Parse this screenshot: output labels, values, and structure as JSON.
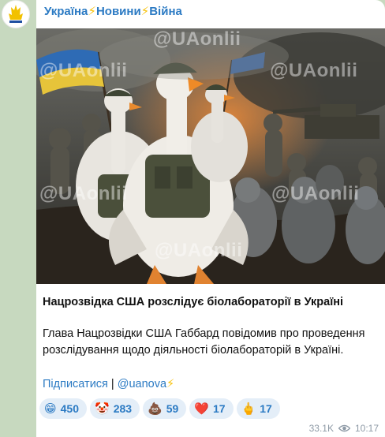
{
  "channel": {
    "header_part1": "Україна",
    "header_part2": "Новини",
    "header_part3": "Війна",
    "header_separator": "⚡"
  },
  "post": {
    "image_watermarks": [
      "@UAonlii",
      "@UAonlii",
      "@UAonlii",
      "@UAonlii",
      "@UAonlii",
      "@UAonlii"
    ],
    "headline": "Нацрозвідка США розслідує біолабораторії в Україні",
    "body_lines": [
      "Глава Нацрозвідки США Габбард повідомив про проведення",
      "розслідування щодо діяльності біолабораторій в Україні."
    ],
    "subscribe_label": "Підписатися",
    "link_separator": " | ",
    "channel_link": "@uanova",
    "link_bolt": "⚡"
  },
  "reactions": [
    {
      "emoji": "😁",
      "count": "450"
    },
    {
      "emoji": "🤡",
      "count": "283"
    },
    {
      "emoji": "💩",
      "count": "59"
    },
    {
      "emoji": "❤️",
      "count": "17"
    },
    {
      "emoji": "🖕",
      "count": "17"
    }
  ],
  "meta": {
    "views": "33.1K",
    "time": "10:17",
    "views_icon": "eye-icon"
  },
  "colors": {
    "link": "#2b7ac3",
    "reaction_bg": "#e4eef8",
    "bolt": "#f7c20b",
    "chat_bg": "#c7d9bf"
  }
}
